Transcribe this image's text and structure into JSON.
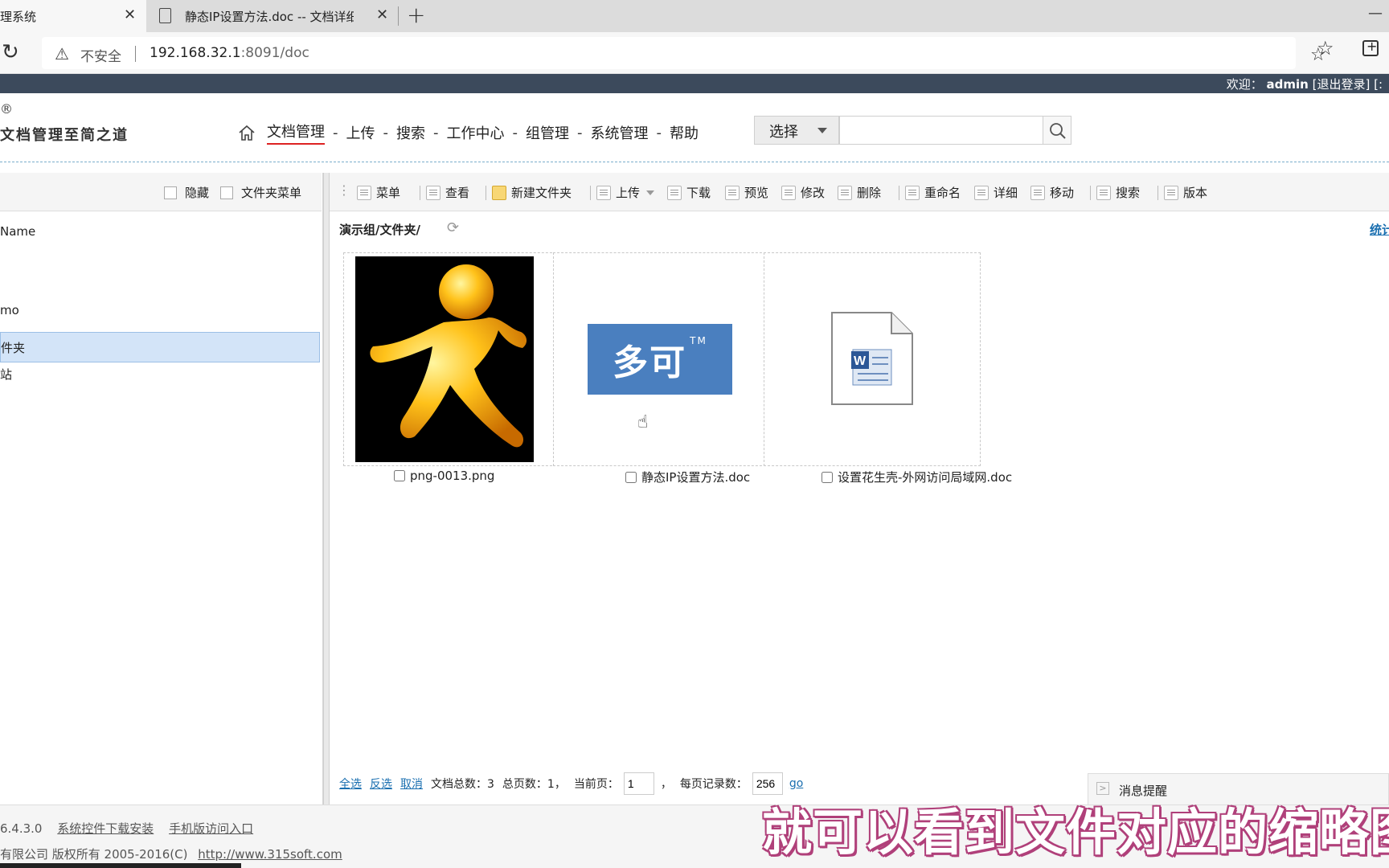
{
  "browser": {
    "tabs": [
      {
        "title": "理系统",
        "close": "✕"
      },
      {
        "title": "静态IP设置方法.doc -- 文档详细(",
        "close": "✕"
      }
    ],
    "new_tab": "+",
    "minimize": "—",
    "security_label": "不安全",
    "url_host": "192.168.32.1",
    "url_rest": ":8091/doc"
  },
  "appbar": {
    "welcome_prefix": "欢迎：",
    "user": "admin",
    "logout": "[退出登录]",
    "extra": "[:"
  },
  "header": {
    "logo_mark": "®",
    "logo_tagline": "文档管理至简之道",
    "nav": [
      "文档管理",
      "上传",
      "搜索",
      "工作中心",
      "组管理",
      "系统管理",
      "帮助"
    ],
    "search_select": "选择"
  },
  "left": {
    "toolbar": {
      "hide": "隐藏",
      "folder_menu": "文件夹菜单"
    },
    "tree": [
      "Name",
      "mo",
      "件夹",
      "站"
    ]
  },
  "toolbar": {
    "buttons": [
      "菜单",
      "查看",
      "新建文件夹",
      "上传",
      "下载",
      "预览",
      "修改",
      "删除",
      "重命名",
      "详细",
      "移动",
      "搜索",
      "版本"
    ]
  },
  "main": {
    "path": "演示组/文件夹/",
    "stats_link": "统计",
    "files": [
      {
        "name": "png-0013.png"
      },
      {
        "name": "静态IP设置方法.doc",
        "thumb_text": "多可",
        "thumb_mark": "TM"
      },
      {
        "name": "设置花生壳-外网访问局域网.doc"
      }
    ]
  },
  "pager": {
    "select_all": "全选",
    "invert": "反选",
    "cancel": "取消",
    "total_docs_label": "文档总数：",
    "total_docs": "3",
    "total_pages_label": "总页数：",
    "total_pages": "1，",
    "current_page_label": "当前页：",
    "current_page": "1",
    "comma": "，",
    "per_page_label": "每页记录数：",
    "per_page": "256",
    "go": "go"
  },
  "message_panel": {
    "label": "消息提醒"
  },
  "footer": {
    "version": "6.4.3.0",
    "links": [
      "系统控件下载安装",
      "手机版访问入口"
    ],
    "copyright": "有限公司 版权所有 2005-2016(C)",
    "site": "http://www.315soft.com"
  },
  "caption": "就可以看到文件对应的缩略图",
  "colors": {
    "appbar": "#3c4a5c",
    "link": "#1a6fb0",
    "selected": "#d3e4f8",
    "logo_blue": "#4a7fbf",
    "caption_stroke": "#b0407a"
  }
}
